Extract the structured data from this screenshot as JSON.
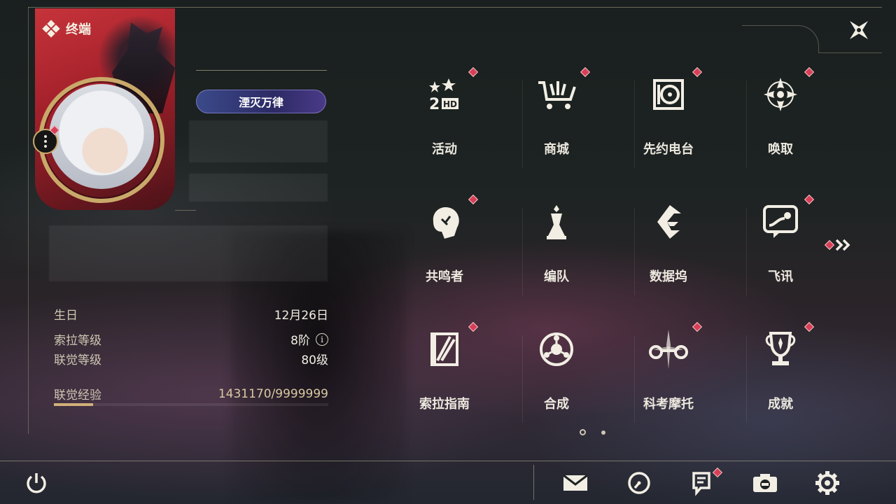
{
  "terminal": {
    "title": "终端"
  },
  "profile": {
    "title_badge": "湮灭万律",
    "info": [
      {
        "label": "生日",
        "value": "12月26日"
      },
      {
        "label": "索拉等级",
        "value": "8阶"
      },
      {
        "label": "联觉等级",
        "value": "80级"
      }
    ],
    "exp": {
      "label": "联觉经验",
      "value": "1431170/9999999",
      "progress_fraction": 0.143
    }
  },
  "functions": [
    {
      "label": "活动",
      "icon": "event-icon",
      "badge": true
    },
    {
      "label": "商城",
      "icon": "shop-icon",
      "badge": true
    },
    {
      "label": "先约电台",
      "icon": "radio-icon",
      "badge": true
    },
    {
      "label": "唤取",
      "icon": "summon-icon",
      "badge": true
    },
    {
      "label": "共鸣者",
      "icon": "resonator-icon",
      "badge": true
    },
    {
      "label": "编队",
      "icon": "team-icon",
      "badge": false
    },
    {
      "label": "数据坞",
      "icon": "data-bank-icon",
      "badge": false
    },
    {
      "label": "飞讯",
      "icon": "message-icon",
      "badge": true
    },
    {
      "label": "索拉指南",
      "icon": "guide-icon",
      "badge": true
    },
    {
      "label": "合成",
      "icon": "synthesis-icon",
      "badge": false
    },
    {
      "label": "科考摩托",
      "icon": "motorcycle-icon",
      "badge": true
    },
    {
      "label": "成就",
      "icon": "trophy-icon",
      "badge": true
    }
  ],
  "pager": {
    "pages": 2,
    "current": 1
  },
  "bottom_bar": [
    "power-icon",
    "mail-icon",
    "clock-icon",
    "notice-icon",
    "camera-icon",
    "settings-icon"
  ],
  "colors": {
    "accent_gold": "#c9a96a",
    "badge_red": "#d64057",
    "title_badge": "#2c2a64"
  }
}
